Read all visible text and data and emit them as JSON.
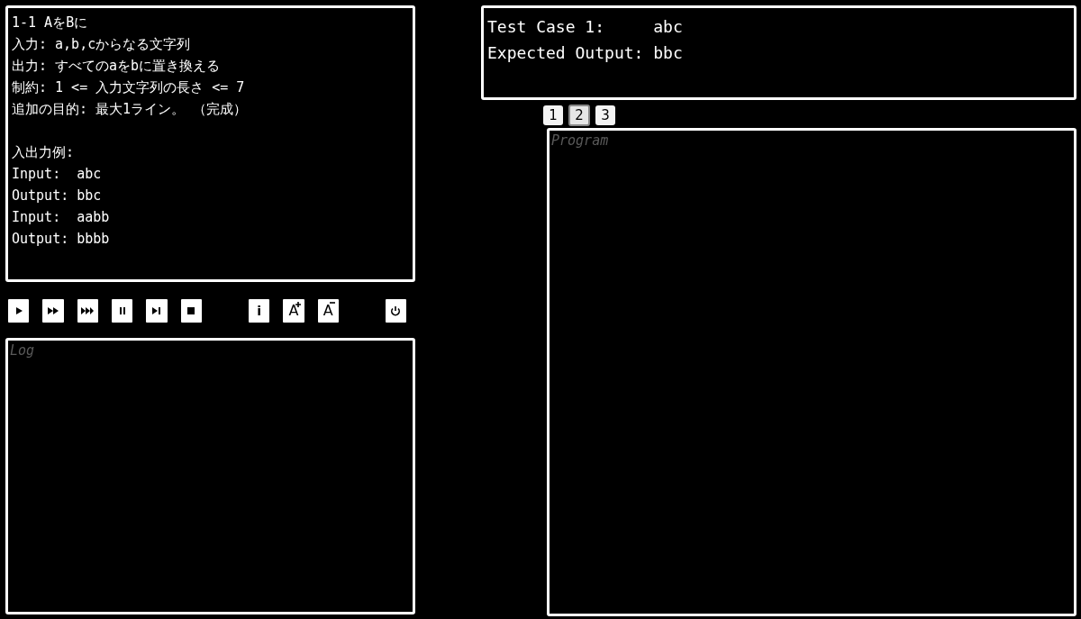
{
  "problem": {
    "lines": [
      "1-1 AをBに",
      "入力: a,b,cからなる文字列",
      "出力: すべてのaをbに置き換える",
      "制約: 1 <= 入力文字列の長さ <= 7",
      "追加の目的: 最大1ライン。 （完成）"
    ],
    "example_lines": [
      "入出力例:",
      "Input:  abc",
      "Output: bbc",
      "Input:  aabb",
      "Output: bbbb"
    ]
  },
  "toolbar": [
    {
      "kind": "play"
    },
    {
      "kind": "fast"
    },
    {
      "kind": "faster"
    },
    {
      "kind": "pause"
    },
    {
      "kind": "step"
    },
    {
      "kind": "stop"
    },
    {
      "kind": "gap"
    },
    {
      "kind": "text",
      "label": "i"
    },
    {
      "kind": "font-up",
      "label": "A"
    },
    {
      "kind": "font-down",
      "label": "A"
    },
    {
      "kind": "gap"
    },
    {
      "kind": "power"
    }
  ],
  "log": {
    "placeholder": "Log"
  },
  "test_case": {
    "lines": [
      "Test Case 1:     abc",
      "Expected Output: bbc"
    ]
  },
  "tabs": [
    {
      "label": "1",
      "selected": false
    },
    {
      "label": "2",
      "selected": true
    },
    {
      "label": "3",
      "selected": false
    }
  ],
  "program": {
    "placeholder": "Program"
  }
}
